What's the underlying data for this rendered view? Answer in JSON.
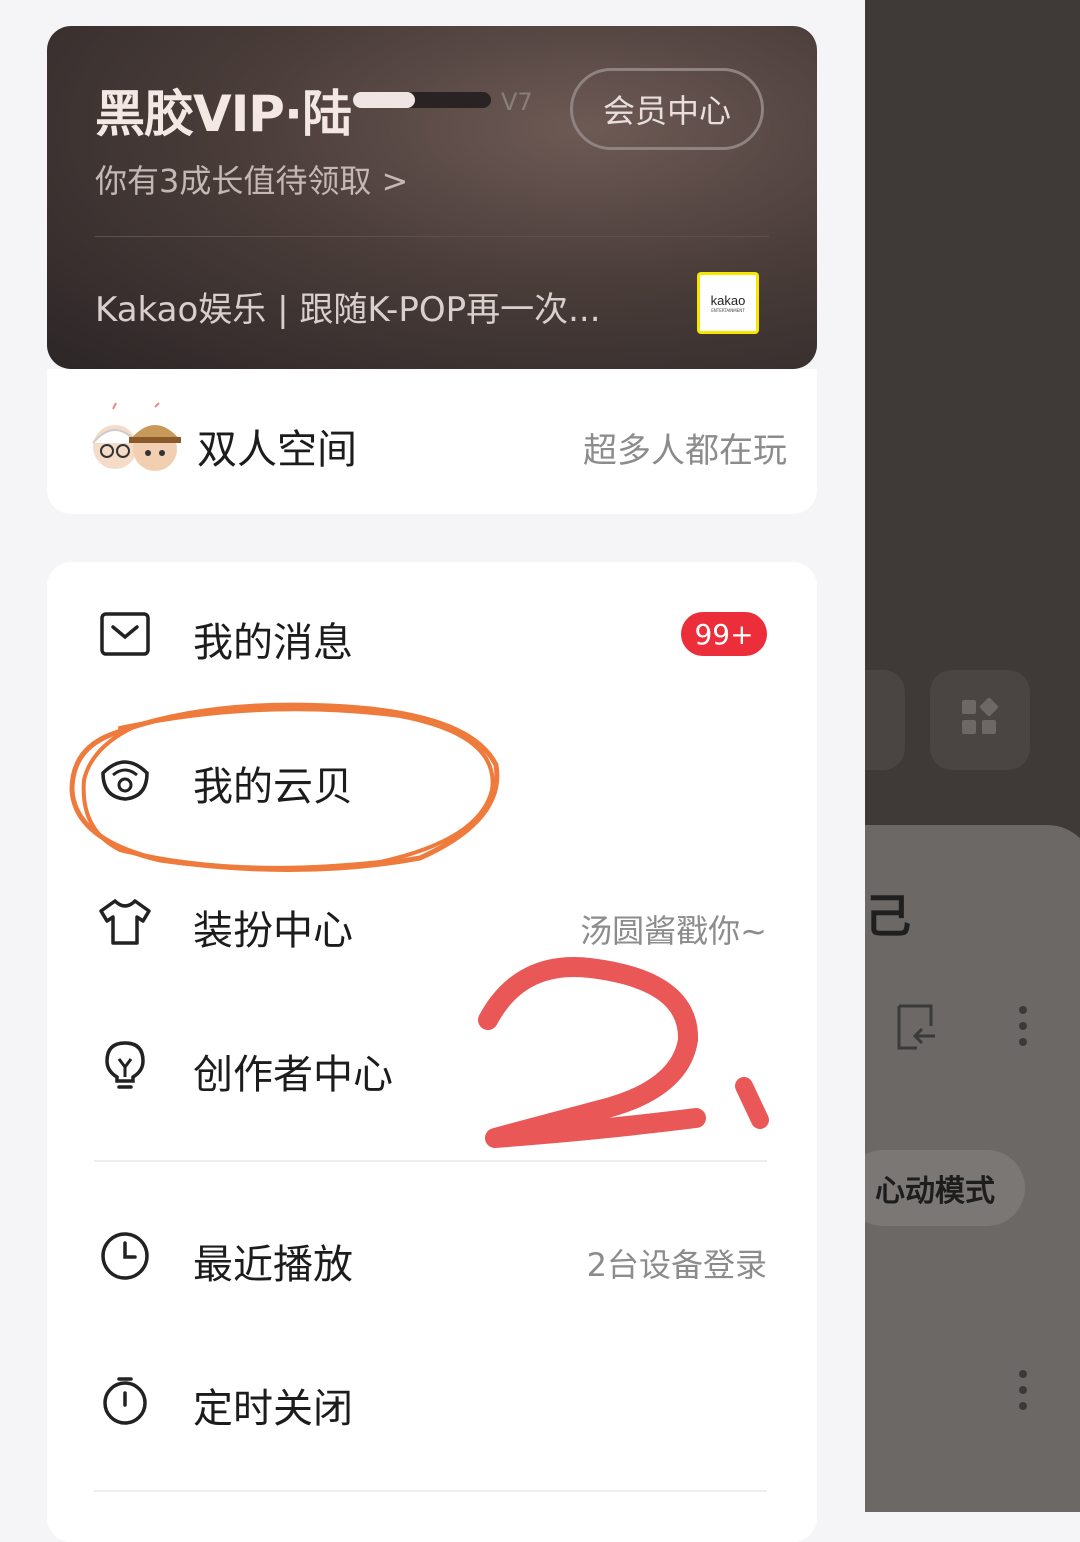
{
  "vip": {
    "title": "黑胶VIP·陆",
    "level": "V7",
    "level_progress": 0.45,
    "center_button": "会员中心",
    "growth_notice": "你有3成长值待领取 >",
    "promo_text": "Kakao娱乐 | 跟随K-POP再一次...",
    "promo_logo_text": "kakao",
    "promo_logo_sub": "ENTERTAINMENT"
  },
  "duo": {
    "label": "双人空间",
    "side_text": "超多人都在玩"
  },
  "menu": {
    "messages": {
      "label": "我的消息",
      "badge": "99+",
      "icon": "mail-icon"
    },
    "cloud_shell": {
      "label": "我的云贝",
      "icon": "cloud-shell-icon"
    },
    "dress_up": {
      "label": "装扮中心",
      "side_text": "汤圆酱戳你~",
      "icon": "tshirt-icon"
    },
    "creator": {
      "label": "创作者中心",
      "icon": "lightbulb-icon"
    },
    "recent": {
      "label": "最近播放",
      "side_text": "2台设备登录",
      "icon": "clock-icon"
    },
    "timer": {
      "label": "定时关闭",
      "icon": "timer-icon"
    }
  },
  "annotation": {
    "number": "2",
    "ring_color": "#ee7a3c",
    "number_color": "#e63a3a"
  },
  "background_app": {
    "partial_text": "己",
    "mode_button": "心动模式"
  }
}
